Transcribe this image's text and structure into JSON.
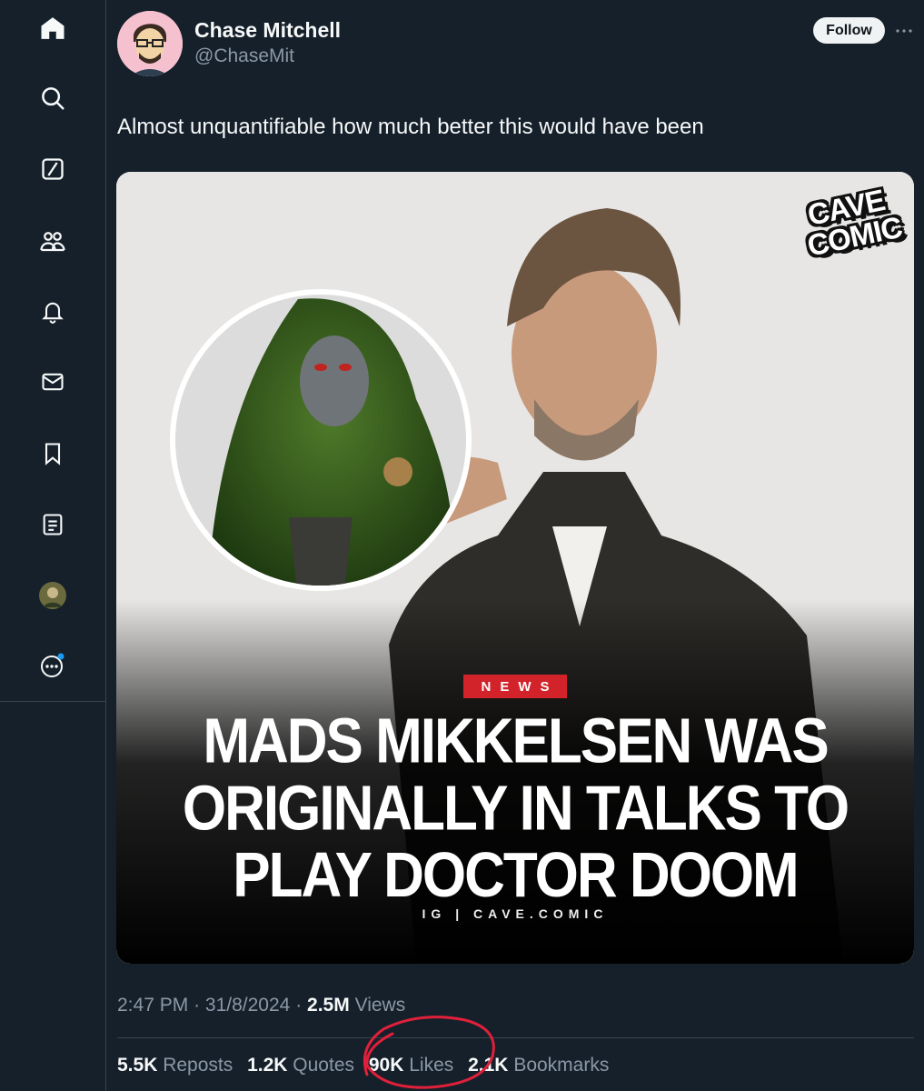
{
  "author": {
    "name": "Chase Mitchell",
    "handle": "@ChaseMit",
    "follow_label": "Follow"
  },
  "tweet": {
    "text": "Almost unquantifiable how much better this would have been",
    "time": "2:47 PM",
    "date": "31/8/2024",
    "views_count": "2.5M",
    "views_label": "Views",
    "separator": "·"
  },
  "media": {
    "logo_line1": "CAVE",
    "logo_line2": "COMIC",
    "badge": "NEWS",
    "headline_lines": [
      "MADS MIKKELSEN WAS",
      "ORIGINALLY IN TALKS TO",
      "PLAY DOCTOR DOOM"
    ],
    "source": "IG | CAVE.COMIC"
  },
  "stats": [
    {
      "count": "5.5K",
      "label": "Reposts"
    },
    {
      "count": "1.2K",
      "label": "Quotes"
    },
    {
      "count": "90K",
      "label": "Likes"
    },
    {
      "count": "2.1K",
      "label": "Bookmarks"
    }
  ],
  "sidebar_icons": [
    "home-icon",
    "search-icon",
    "grok-icon",
    "communities-icon",
    "notifications-icon",
    "messages-icon",
    "bookmarks-icon",
    "lists-icon",
    "profile-avatar",
    "more-icon"
  ],
  "colors": {
    "background": "#15202b",
    "text_primary": "#f7f9f9",
    "text_secondary": "#8b98a5",
    "border": "#38444d",
    "badge_red": "#d3232a",
    "annotation_red": "#e0203a",
    "notification_dot": "#1d9bf0"
  }
}
